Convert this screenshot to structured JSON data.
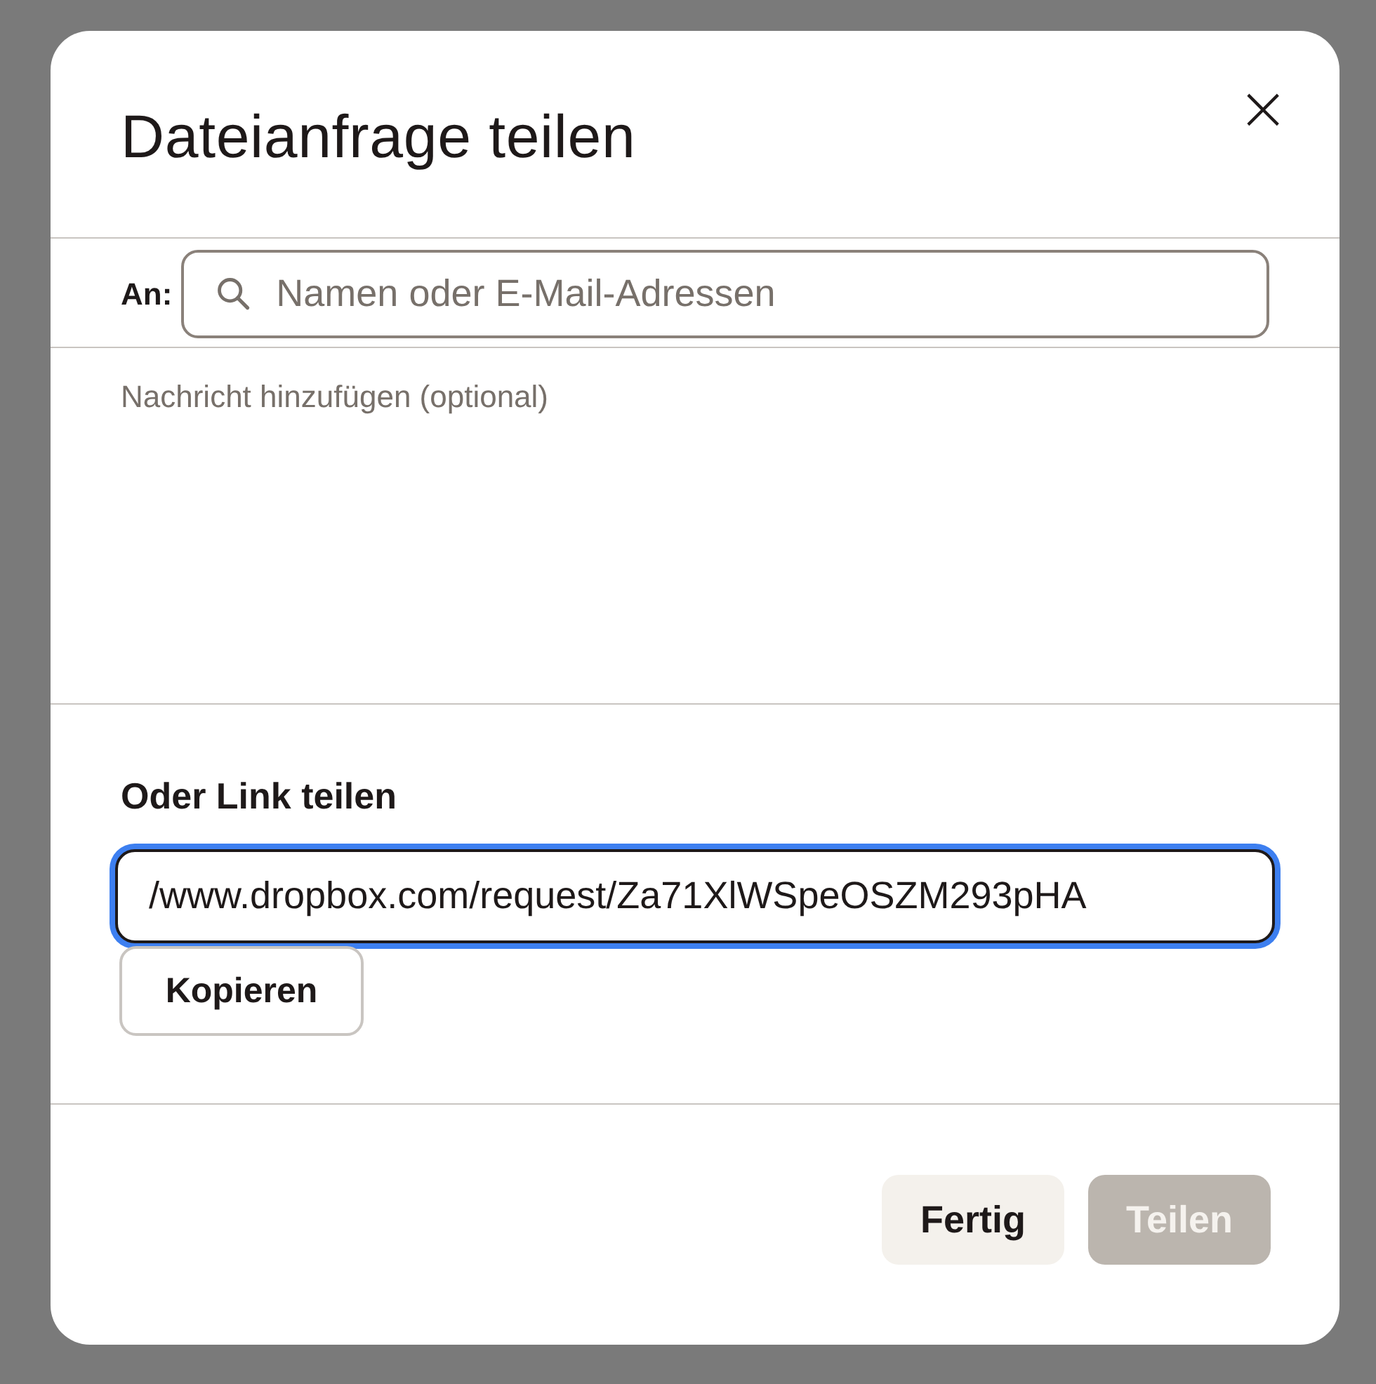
{
  "dialog": {
    "title": "Dateianfrage teilen",
    "close_label": "×"
  },
  "recipients": {
    "label": "An:",
    "placeholder": "Namen oder E-Mail-Adressen"
  },
  "message": {
    "placeholder": "Nachricht hinzufügen (optional)"
  },
  "link_section": {
    "heading": "Oder Link teilen",
    "link": "/www.dropbox.com/request/Za71XlWSpeOSZM293pHA",
    "focused": true,
    "copy_button": "Kopieren"
  },
  "buttons": [
    {
      "label": "Fertig",
      "disabled": false,
      "kind": "secondary"
    },
    {
      "label": "Teilen",
      "disabled": true,
      "kind": "primary"
    }
  ]
}
